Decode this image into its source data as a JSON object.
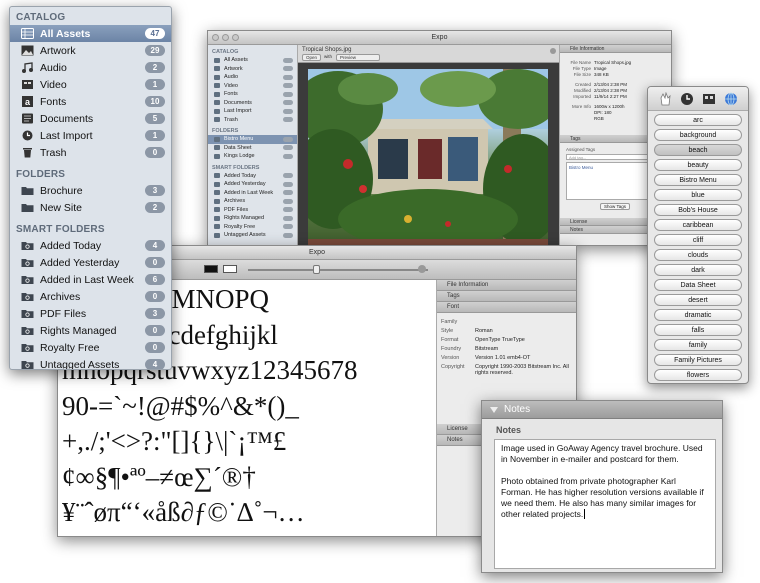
{
  "catalog_panel": {
    "catalog_heading": "CATALOG",
    "catalog_items": [
      {
        "label": "All Assets",
        "count": "47",
        "icon": "all-assets-icon",
        "selected": true
      },
      {
        "label": "Artwork",
        "count": "29",
        "icon": "artwork-icon"
      },
      {
        "label": "Audio",
        "count": "2",
        "icon": "audio-icon"
      },
      {
        "label": "Video",
        "count": "1",
        "icon": "video-icon"
      },
      {
        "label": "Fonts",
        "count": "10",
        "icon": "fonts-icon"
      },
      {
        "label": "Documents",
        "count": "5",
        "icon": "documents-icon"
      },
      {
        "label": "Last Import",
        "count": "1",
        "icon": "clock-icon"
      },
      {
        "label": "Trash",
        "count": "0",
        "icon": "trash-icon"
      }
    ],
    "folders_heading": "FOLDERS",
    "folder_items": [
      {
        "label": "Brochure",
        "count": "3"
      },
      {
        "label": "New Site",
        "count": "2"
      }
    ],
    "smart_heading": "SMART FOLDERS",
    "smart_items": [
      {
        "label": "Added Today",
        "count": "4"
      },
      {
        "label": "Added Yesterday",
        "count": "0"
      },
      {
        "label": "Added in Last Week",
        "count": "6"
      },
      {
        "label": "Archives",
        "count": "0"
      },
      {
        "label": "PDF Files",
        "count": "3"
      },
      {
        "label": "Rights Managed",
        "count": "0"
      },
      {
        "label": "Royalty Free",
        "count": "0"
      },
      {
        "label": "Untagged Assets",
        "count": "4"
      }
    ]
  },
  "main_window": {
    "title": "Expo",
    "file_title": "Tropical Shops.jpg",
    "open_label": "Open",
    "with_label": "with",
    "app_label": "Preview",
    "sidebar": {
      "catalog_heading": "CATALOG",
      "catalog_items": [
        "All Assets",
        "Artwork",
        "Audio",
        "Video",
        "Fonts",
        "Documents",
        "Last Import",
        "Trash"
      ],
      "folders_heading": "FOLDERS",
      "folder_items": [
        "Bistro Menu",
        "Data Sheet",
        "Kings Lodge"
      ],
      "smart_heading": "SMART FOLDERS",
      "smart_items": [
        "Added Today",
        "Added Yesterday",
        "Added in Last Week",
        "Archives",
        "PDF Files",
        "Rights Managed",
        "Royalty Free",
        "Untagged Assets"
      ]
    },
    "info": {
      "file_info_heading": "File Information",
      "fields": [
        {
          "k": "File Name",
          "v": "Tropical Shops.jpg"
        },
        {
          "k": "File Type",
          "v": "Image"
        },
        {
          "k": "File Size",
          "v": "348 KB"
        },
        {
          "k": "Created",
          "v": "2/13/04 2:38 PM"
        },
        {
          "k": "Modified",
          "v": "2/13/04 2:38 PM"
        },
        {
          "k": "Imported",
          "v": "11/9/14 2:27 PM"
        },
        {
          "k": "More Info",
          "v": "1600w x 1200h"
        },
        {
          "k": "",
          "v": "DPI: 180"
        },
        {
          "k": "",
          "v": "RGB"
        }
      ],
      "tags_heading": "Tags",
      "assigned_tags_label": "Assigned Tags",
      "add_tag_placeholder": "Add tag...",
      "assigned_tag": "Bistro Menu",
      "show_tags_label": "Show Tags",
      "license_heading": "License",
      "notes_heading": "Notes"
    }
  },
  "tag_palette": {
    "tags": [
      "arc",
      "background",
      "beach",
      "beauty",
      "Bistro Menu",
      "blue",
      "Bob's House",
      "caribbean",
      "cliff",
      "clouds",
      "dark",
      "Data Sheet",
      "desert",
      "dramatic",
      "falls",
      "family",
      "Family Pictures",
      "flowers"
    ],
    "active_tag": "beach"
  },
  "font_window": {
    "title": "Expo",
    "sample_lines": [
      "FGHIJKLMNOPQ",
      "WXYZabcdefghijkl",
      "mnopqrstuvwxyz12345678",
      "90-=`~!@#$%^&*()_",
      "+,./;'<>?:\"[]{}\\|`¡™£",
      "¢∞§¶•ªº–≠œ∑´®†",
      "¥¨ˆøπ“‘«åß∂ƒ©˙∆˚¬…"
    ],
    "file_info_heading": "File Information",
    "tags_heading": "Tags",
    "font_heading": "Font",
    "fields": [
      {
        "k": "Family",
        "v": ""
      },
      {
        "k": "Style",
        "v": "Roman"
      },
      {
        "k": "Format",
        "v": "OpenType TrueType"
      },
      {
        "k": "Foundry",
        "v": "Bitstream"
      },
      {
        "k": "Version",
        "v": "Version 1.01 emb4-OT"
      },
      {
        "k": "Copyright",
        "v": "Copyright 1990-2003 Bitstream Inc. All rights reserved."
      }
    ],
    "license_heading": "License",
    "notes_heading": "Notes"
  },
  "notes_panel": {
    "header": "Notes",
    "sub_label": "Notes",
    "paragraph_1": "Image used in GoAway Agency travel brochure. Used in November in e-mailer and postcard for them.",
    "paragraph_2": "Photo obtained from private photographer Karl Forman. He has higher resolution versions available if we need them. He also has many similar images for other related projects."
  },
  "colors": {
    "selection": "#7088a8",
    "badge": "#8c97a6",
    "sidebar_bg": "#dde3ea"
  }
}
